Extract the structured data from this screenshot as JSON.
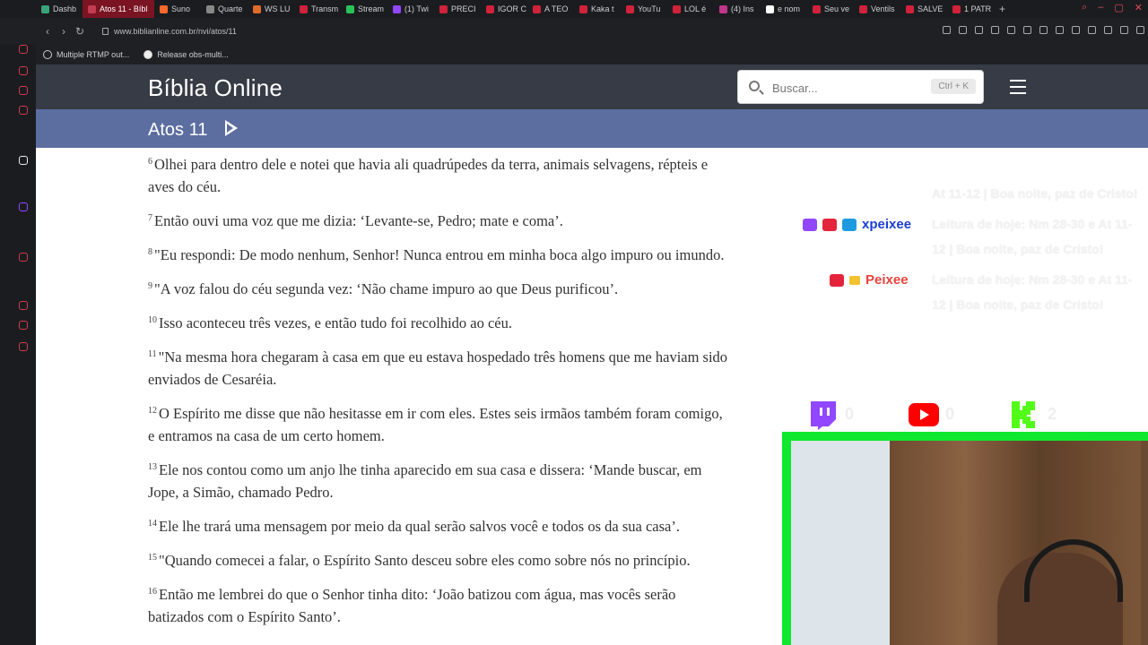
{
  "browser": {
    "tabs": [
      {
        "label": "Dashb",
        "color": "#3aa37a"
      },
      {
        "label": "Atos 11 - Bíbl",
        "color": "#c43c4f",
        "active": true
      },
      {
        "label": "Suno",
        "color": "#ff6a2a"
      },
      {
        "label": "Quarte",
        "color": "#888888"
      },
      {
        "label": "WS LU",
        "color": "#e06b2a"
      },
      {
        "label": "Transm",
        "color": "#d0223a"
      },
      {
        "label": "Stream",
        "color": "#29c35a"
      },
      {
        "label": "(1) Twi",
        "color": "#9146ff"
      },
      {
        "label": "PRECI",
        "color": "#d0223a"
      },
      {
        "label": "IGOR C",
        "color": "#d0223a"
      },
      {
        "label": "A TEO",
        "color": "#d0223a"
      },
      {
        "label": "Kaka t",
        "color": "#d0223a"
      },
      {
        "label": "YouTu",
        "color": "#d0223a"
      },
      {
        "label": "LOL é",
        "color": "#d0223a"
      },
      {
        "label": "(4) Ins",
        "color": "#c1358a"
      },
      {
        "label": "e nom",
        "color": "#ffffff"
      },
      {
        "label": "Seu ve",
        "color": "#d0223a"
      },
      {
        "label": "Ventils",
        "color": "#d0223a"
      },
      {
        "label": "SALVE",
        "color": "#d0223a"
      },
      {
        "label": "1 PATR",
        "color": "#d0223a"
      }
    ],
    "url": "www.biblianline.com.br/nvi/atos/11",
    "bookmarks": [
      "Multiple RTMP out...",
      "Release obs-multi..."
    ]
  },
  "site": {
    "logo": "Bíblia Online",
    "search_placeholder": "Buscar...",
    "search_shortcut": "Ctrl + K",
    "chapter": "Atos 11"
  },
  "verses": [
    {
      "num": "6",
      "text": "Olhei para dentro dele e notei que havia ali quadrúpedes da terra, animais selvagens, répteis e aves do céu."
    },
    {
      "num": "7",
      "text": "Então ouvi uma voz que me dizia: ‘Levante-se, Pedro; mate e coma’."
    },
    {
      "num": "8",
      "text": "\"Eu respondi: De modo nenhum, Senhor! Nunca entrou em minha boca algo impuro ou imundo."
    },
    {
      "num": "9",
      "text": "\"A voz falou do céu segunda vez: ‘Não chame impuro ao que Deus purificou’."
    },
    {
      "num": "10",
      "text": "Isso aconteceu três vezes, e então tudo foi recolhido ao céu."
    },
    {
      "num": "11",
      "text": "\"Na mesma hora chegaram à casa em que eu estava hospedado três homens que me haviam sido enviados de Cesaréia."
    },
    {
      "num": "12",
      "text": "O Espírito me disse que não hesitasse em ir com eles. Estes seis irmãos também foram comigo, e entramos na casa de um certo homem."
    },
    {
      "num": "13",
      "text": "Ele nos contou como um anjo lhe tinha aparecido em sua casa e dissera: ‘Mande buscar, em Jope, a Simão, chamado Pedro."
    },
    {
      "num": "14",
      "text": "Ele lhe trará uma mensagem por meio da qual serão salvos você e todos os da sua casa’."
    },
    {
      "num": "15",
      "text": "\"Quando comecei a falar, o Espírito Santo desceu sobre eles como sobre nós no princípio."
    },
    {
      "num": "16",
      "text": "Então me lembrei do que o Senhor tinha dito: ‘João batizou com água, mas vocês serão batizados com o Espírito Santo’."
    }
  ],
  "overlay": {
    "chat_top": "At 11-12 | Boa noite, paz de Cristo!",
    "msg1_user": "xpeixee",
    "msg1_user_color": "#1a3fd1",
    "msg1_text": "Leitura de hoje: Nm 28-30 e At 11-12 | Boa noite, paz de Cristo!",
    "msg2_user": "Peixee",
    "msg2_user_color": "#e7433c",
    "msg2_text": "Leitura de hoje: Nm 28-30 e At 11-12 | Boa noite, paz de Cristo!",
    "counts": {
      "twitch": "0",
      "youtube": "0",
      "kick": "2"
    },
    "webcam_border_color": "#0fe82e"
  }
}
